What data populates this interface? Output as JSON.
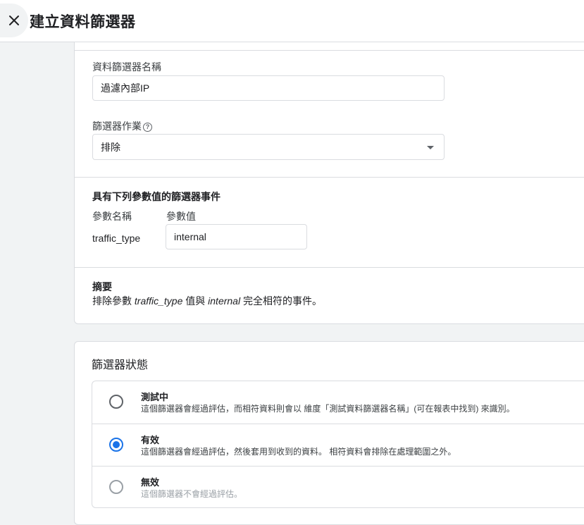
{
  "header": {
    "title": "建立資料篩選器",
    "close_icon": "close-icon"
  },
  "filter_name": {
    "label": "資料篩選器名稱",
    "value": "過濾內部IP"
  },
  "filter_operation": {
    "label": "篩選器作業",
    "help_icon": "help-circle-icon",
    "help_glyph": "?",
    "selected": "排除",
    "dropdown_icon": "arrow-drop-down-icon"
  },
  "params": {
    "title": "具有下列參數值的篩選器事件",
    "name_header": "參數名稱",
    "value_header": "參數值",
    "name": "traffic_type",
    "value": "internal"
  },
  "summary": {
    "title": "摘要",
    "prefix": "排除參數 ",
    "param": "traffic_type",
    "middle": " 值與 ",
    "value": "internal",
    "suffix": " 完全相符的事件。"
  },
  "status": {
    "title": "篩選器狀態",
    "selected_index": 1,
    "options": [
      {
        "label": "測試中",
        "description": "這個篩選器會經過評估，而相符資料則會以 維度「測試資料篩選器名稱」(可在報表中找到) 來識別。"
      },
      {
        "label": "有效",
        "description": "這個篩選器會經過評估，然後套用到收到的資料。 相符資料會排除在處理範圍之外。"
      },
      {
        "label": "無效",
        "description": "這個篩選器不會經過評估。"
      }
    ]
  },
  "colors": {
    "accent": "#1a73e8",
    "border": "#dadce0",
    "page_bg": "#f1f3f4"
  }
}
